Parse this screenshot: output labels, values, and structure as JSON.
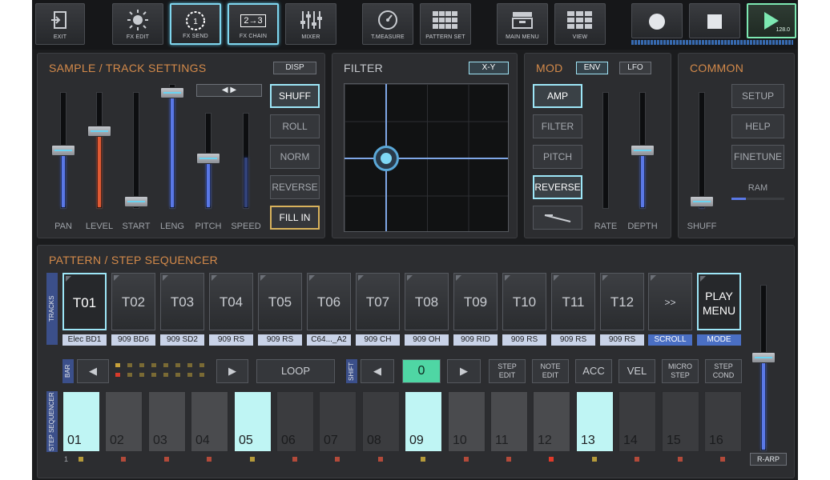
{
  "toolbar": {
    "exit": "EXIT",
    "fx_edit": "FX EDIT",
    "fx_send": "FX SEND",
    "fx_chain": "FX CHAIN",
    "fx_chain_glyph": "2→3",
    "mixer": "MIXER",
    "tmeasure": "T.MEASURE",
    "pattern_set": "PATTERN SET",
    "main_menu": "MAIN MENU",
    "view": "VIEW",
    "tempo": "128.0"
  },
  "sample_panel": {
    "title": "SAMPLE / TRACK SETTINGS",
    "disp": "DISP",
    "faders": [
      "PAN",
      "LEVEL",
      "START",
      "LENG",
      "PITCH",
      "SPEED"
    ],
    "options": [
      "SHUFF",
      "ROLL",
      "NORM",
      "REVERSE",
      "FILL IN"
    ]
  },
  "filter_panel": {
    "title": "FILTER",
    "xy": "X-Y"
  },
  "mod_panel": {
    "title": "MOD",
    "env": "ENV",
    "lfo": "LFO",
    "options": [
      "AMP",
      "FILTER",
      "PITCH",
      "REVERSE"
    ],
    "faders": [
      "RATE",
      "DEPTH"
    ]
  },
  "common_panel": {
    "title": "COMMON",
    "fader": "SHUFF",
    "buttons": [
      "SETUP",
      "HELP",
      "FINETUNE"
    ],
    "ram": "RAM"
  },
  "sequencer": {
    "title": "PATTERN / STEP SEQUENCER",
    "tracks_label": "TRACKS",
    "tracks": [
      {
        "id": "T01",
        "label": "Elec BD1"
      },
      {
        "id": "T02",
        "label": "909 BD6"
      },
      {
        "id": "T03",
        "label": "909 SD2"
      },
      {
        "id": "T04",
        "label": "909 RS"
      },
      {
        "id": "T05",
        "label": "909 RS"
      },
      {
        "id": "T06",
        "label": "C64..._A2"
      },
      {
        "id": "T07",
        "label": "909 CH"
      },
      {
        "id": "T08",
        "label": "909 OH"
      },
      {
        "id": "T09",
        "label": "909 RID"
      },
      {
        "id": "T10",
        "label": "909 RS"
      },
      {
        "id": "T11",
        "label": "909 RS"
      },
      {
        "id": "T12",
        "label": "909 RS"
      }
    ],
    "scroll_glyph": ">>",
    "scroll_label": "SCROLL",
    "play_menu": "PLAY MENU",
    "mode_label": "MODE",
    "bar_label": "BAR",
    "loop": "LOOP",
    "shift_label": "SHIFT",
    "shift_value": "0",
    "step_edit": "STEP EDIT",
    "note_edit": "NOTE EDIT",
    "acc": "ACC",
    "vel": "VEL",
    "micro_step": "MICRO STEP",
    "step_cond": "STEP COND",
    "step_seq_label": "STEP SEQUENCER",
    "steps": [
      "01",
      "02",
      "03",
      "04",
      "05",
      "06",
      "07",
      "08",
      "09",
      "10",
      "11",
      "12",
      "13",
      "14",
      "15",
      "16"
    ],
    "lit_steps": [
      1,
      5,
      9,
      13
    ],
    "bar_number": "1",
    "r_arp": "R-ARP"
  },
  "colors": {
    "accent_orange": "#d48a4a",
    "highlight_cyan": "#9de6f7",
    "fader_blue": "#5a78e6",
    "play_green": "#7de8b2"
  }
}
